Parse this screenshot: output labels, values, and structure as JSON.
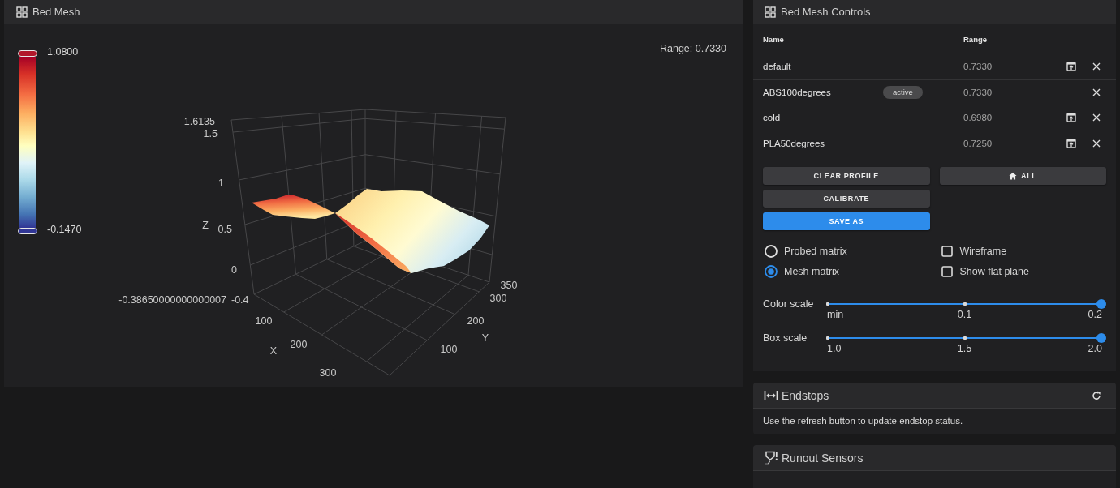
{
  "bed_mesh": {
    "title": "Bed Mesh",
    "range": "Range: 0.7330",
    "color_scale": {
      "max": "1.0800",
      "min": "-0.1470"
    },
    "plot": {
      "z_title": "Z",
      "z_ticks": [
        "1.6135",
        "1.5",
        "1",
        "0.5",
        "0"
      ],
      "z_floor_ticks": [
        "-0.38650000000000007",
        "-0.4"
      ],
      "x_title": "X",
      "x_ticks": [
        "100",
        "200",
        "300"
      ],
      "y_title": "Y",
      "y_ticks": [
        "100",
        "200",
        "300",
        "350"
      ]
    }
  },
  "bed_mesh_controls": {
    "title": "Bed Mesh Controls",
    "columns": [
      "Name",
      "Range"
    ],
    "active_badge": "active",
    "profiles": [
      {
        "name": "default",
        "range": "0.7330",
        "active": false
      },
      {
        "name": "ABS100degrees",
        "range": "0.7330",
        "active": true
      },
      {
        "name": "cold",
        "range": "0.6980",
        "active": false
      },
      {
        "name": "PLA50degrees",
        "range": "0.7250",
        "active": false
      }
    ],
    "left_buttons": [
      {
        "label": "CLEAR PROFILE",
        "kind": "plain"
      },
      {
        "label": "CALIBRATE",
        "kind": "plain"
      },
      {
        "label": "SAVE AS",
        "kind": "primary"
      }
    ],
    "right_buttons": [
      {
        "label": "ALL",
        "kind": "home"
      }
    ],
    "matrix_options": [
      {
        "label": "Probed matrix",
        "selected": false
      },
      {
        "label": "Mesh matrix",
        "selected": true
      }
    ],
    "toggles": [
      {
        "label": "Wireframe",
        "checked": false
      },
      {
        "label": "Show flat plane",
        "checked": false
      }
    ],
    "sliders": [
      {
        "label": "Color scale",
        "level": 1,
        "ticks": [
          "min",
          "0.1",
          "0.2"
        ]
      },
      {
        "label": "Box scale",
        "level": 1,
        "ticks": [
          "1.0",
          "1.5",
          "2.0"
        ]
      }
    ]
  },
  "endstops": {
    "title": "Endstops",
    "message": "Use the refresh button to update endstop status."
  },
  "runout_sensors": {
    "title": "Runout Sensors"
  }
}
